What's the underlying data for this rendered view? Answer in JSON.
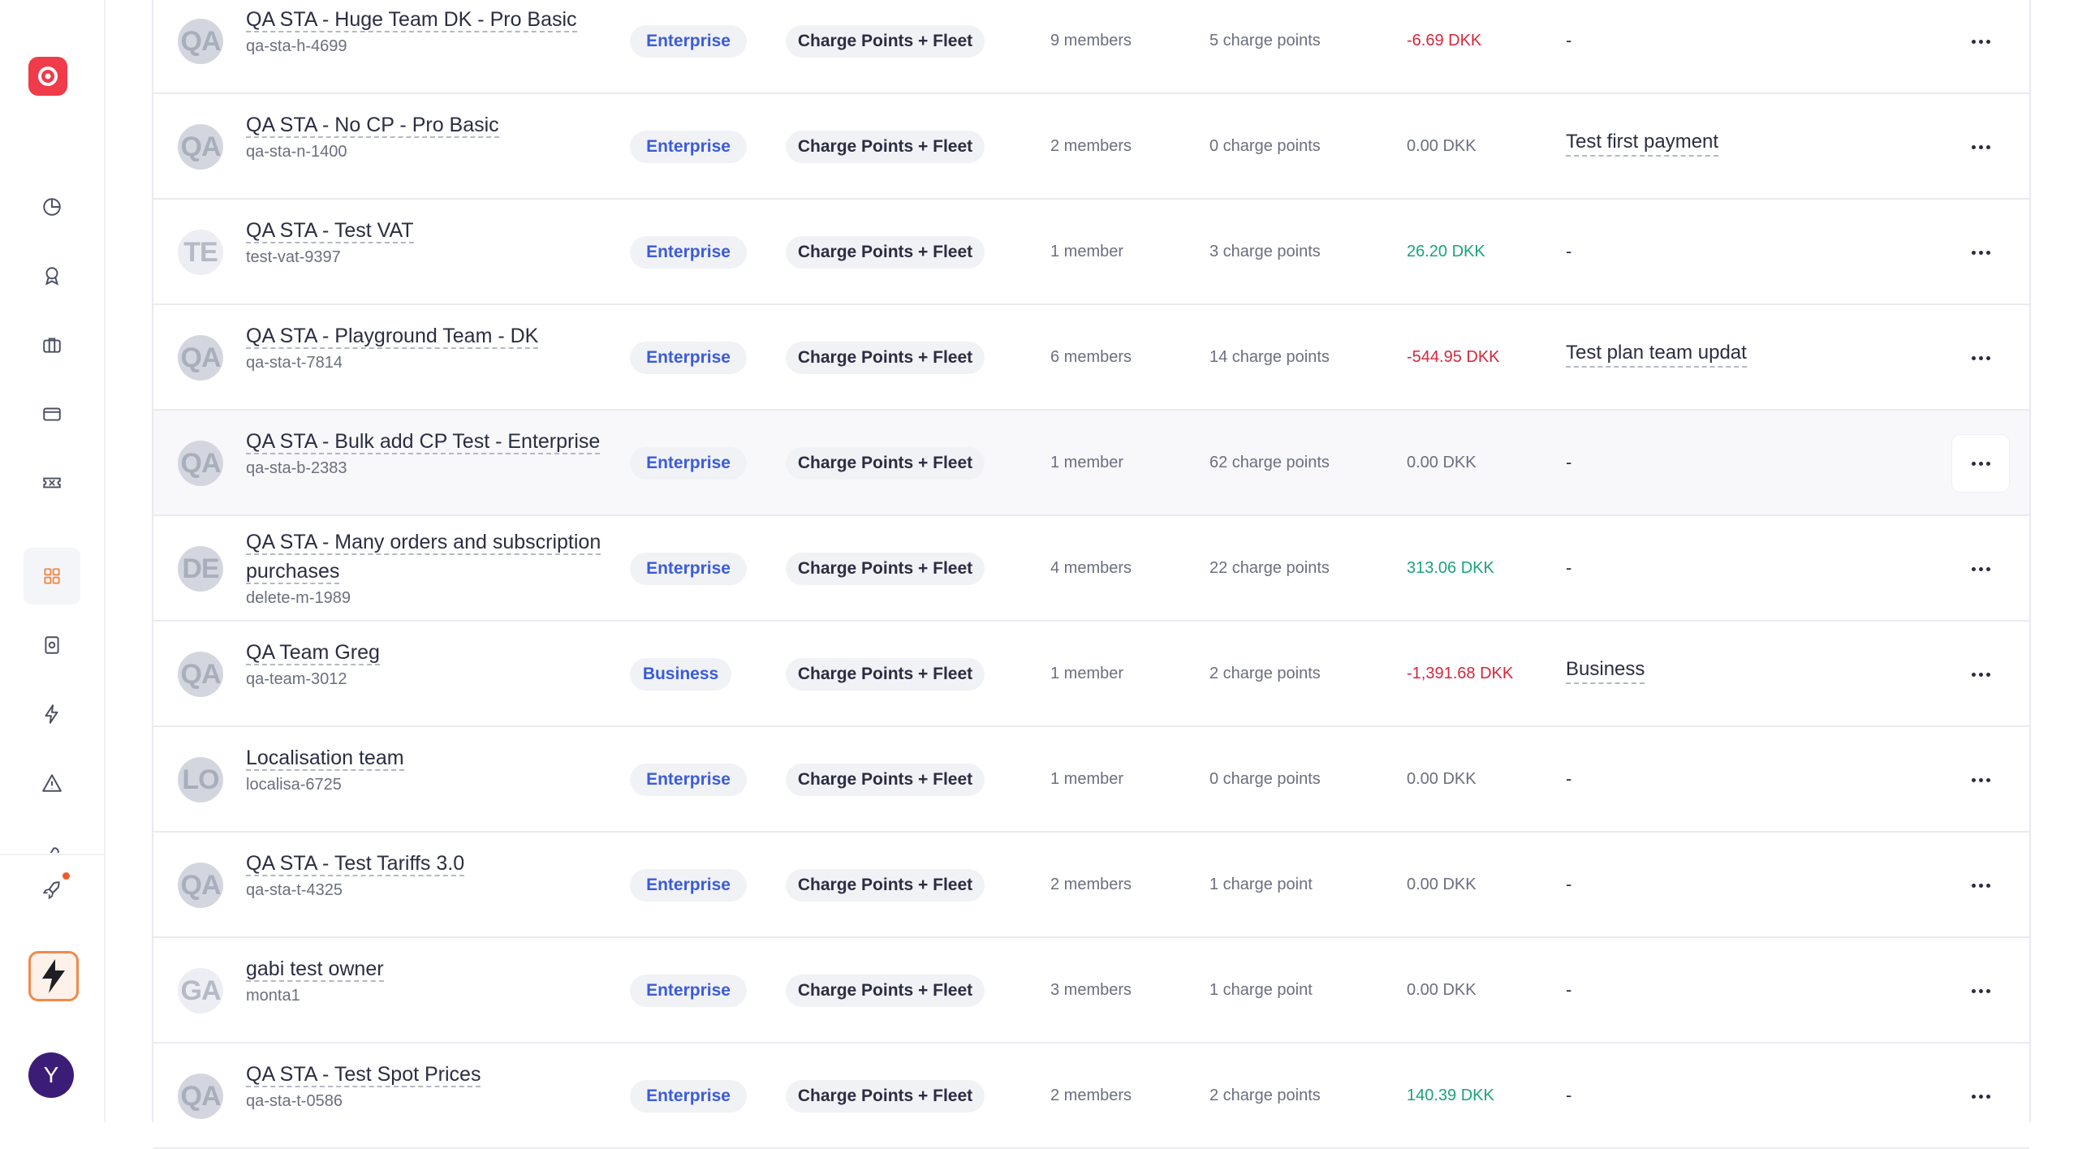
{
  "sidebar": {
    "nav_icons": [
      "dashboard-icon",
      "award-icon",
      "briefcase-icon",
      "card-icon",
      "ticket-icon",
      "grid-icon",
      "device-icon",
      "bolt-icon",
      "warning-icon",
      "tools-icon"
    ],
    "active_item": "grid-icon",
    "rocket_icon": "rocket-icon",
    "user_initial": "Y"
  },
  "colors": {
    "brand": "#ef3b4a",
    "plan_text": "#3b5bdb",
    "negative": "#d6263b",
    "positive": "#1aa37a",
    "active_nav": "#f08a4b"
  },
  "rows": [
    {
      "initials": "QA",
      "name": "QA STA - Huge Team DK - Pro Basic",
      "handle": "qa-sta-h-4699",
      "plan": "Enterprise",
      "scope": "Charge Points + Fleet",
      "members": "9  members",
      "charge_points": "5  charge points",
      "balance": "-6.69 DKK",
      "balance_sign": "neg",
      "note": "-"
    },
    {
      "initials": "QA",
      "name": "QA STA - No CP - Pro Basic",
      "handle": "qa-sta-n-1400",
      "plan": "Enterprise",
      "scope": "Charge Points + Fleet",
      "members": "2  members",
      "charge_points": "0  charge points",
      "balance": "0.00 DKK",
      "balance_sign": "zero",
      "note": "Test first payment"
    },
    {
      "initials": "TE",
      "name": "QA STA - Test VAT",
      "handle": "test-vat-9397",
      "plan": "Enterprise",
      "scope": "Charge Points + Fleet",
      "members": "1 member",
      "charge_points": "3  charge points",
      "balance": "26.20 DKK",
      "balance_sign": "pos",
      "note": "-"
    },
    {
      "initials": "QA",
      "name": "QA STA - Playground Team - DK",
      "handle": "qa-sta-t-7814",
      "plan": "Enterprise",
      "scope": "Charge Points + Fleet",
      "members": "6  members",
      "charge_points": "14  charge points",
      "balance": "-544.95 DKK",
      "balance_sign": "neg",
      "note": "Test plan team updat"
    },
    {
      "initials": "QA",
      "name": "QA STA - Bulk add CP Test - Enterprise",
      "handle": "qa-sta-b-2383",
      "plan": "Enterprise",
      "scope": "Charge Points + Fleet",
      "members": "1 member",
      "charge_points": "62  charge points",
      "balance": "0.00 DKK",
      "balance_sign": "zero",
      "note": "-"
    },
    {
      "initials": "DE",
      "name": "QA STA - Many orders and subscription purchases",
      "handle": "delete-m-1989",
      "plan": "Enterprise",
      "scope": "Charge Points + Fleet",
      "members": "4  members",
      "charge_points": "22  charge points",
      "balance": "313.06 DKK",
      "balance_sign": "pos",
      "note": "-"
    },
    {
      "initials": "QA",
      "name": "QA Team Greg",
      "handle": "qa-team-3012",
      "plan": "Business",
      "scope": "Charge Points + Fleet",
      "members": "1 member",
      "charge_points": "2  charge points",
      "balance": "-1,391.68 DKK",
      "balance_sign": "neg",
      "note": "Business"
    },
    {
      "initials": "LO",
      "name": "Localisation team",
      "handle": "localisa-6725",
      "plan": "Enterprise",
      "scope": "Charge Points + Fleet",
      "members": "1 member",
      "charge_points": "0  charge points",
      "balance": "0.00 DKK",
      "balance_sign": "zero",
      "note": "-"
    },
    {
      "initials": "QA",
      "name": "QA STA - Test Tariffs 3.0",
      "handle": "qa-sta-t-4325",
      "plan": "Enterprise",
      "scope": "Charge Points + Fleet",
      "members": "2  members",
      "charge_points": "1 charge point",
      "balance": "0.00 DKK",
      "balance_sign": "zero",
      "note": "-"
    },
    {
      "initials": "GA",
      "name": "gabi test owner",
      "handle": "monta1",
      "plan": "Enterprise",
      "scope": "Charge Points + Fleet",
      "members": "3  members",
      "charge_points": "1 charge point",
      "balance": "0.00 DKK",
      "balance_sign": "zero",
      "note": "-"
    },
    {
      "initials": "QA",
      "name": "QA STA - Test Spot Prices",
      "handle": "qa-sta-t-0586",
      "plan": "Enterprise",
      "scope": "Charge Points + Fleet",
      "members": "2  members",
      "charge_points": "2  charge points",
      "balance": "140.39 DKK",
      "balance_sign": "pos",
      "note": "-"
    }
  ]
}
